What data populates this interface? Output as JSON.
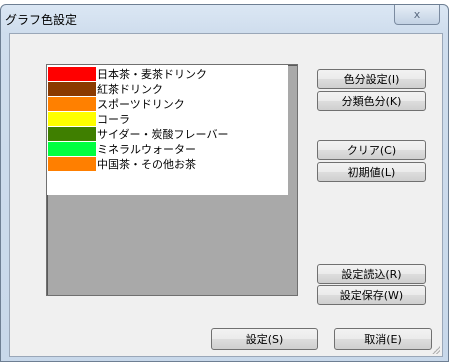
{
  "window": {
    "title": "グラフ色設定",
    "close_label": "x"
  },
  "list": {
    "items": [
      {
        "label": "日本茶・麦茶ドリンク",
        "color": "#ff0000"
      },
      {
        "label": "紅茶ドリンク",
        "color": "#8b3a00"
      },
      {
        "label": "スポーツドリンク",
        "color": "#ff8000"
      },
      {
        "label": "コーラ",
        "color": "#ffff00"
      },
      {
        "label": "サイダー・炭酸フレーバー",
        "color": "#3f7f00"
      },
      {
        "label": "ミネラルウォーター",
        "color": "#00ff40"
      },
      {
        "label": "中国茶・その他お茶",
        "color": "#ff7f00"
      }
    ]
  },
  "buttons": {
    "color_setting": "色分設定(I)",
    "category_color": "分類色分(K)",
    "clear": "クリア(C)",
    "initial": "初期値(L)",
    "load": "設定読込(R)",
    "save": "設定保存(W)",
    "ok": "設定(S)",
    "cancel": "取消(E)"
  }
}
